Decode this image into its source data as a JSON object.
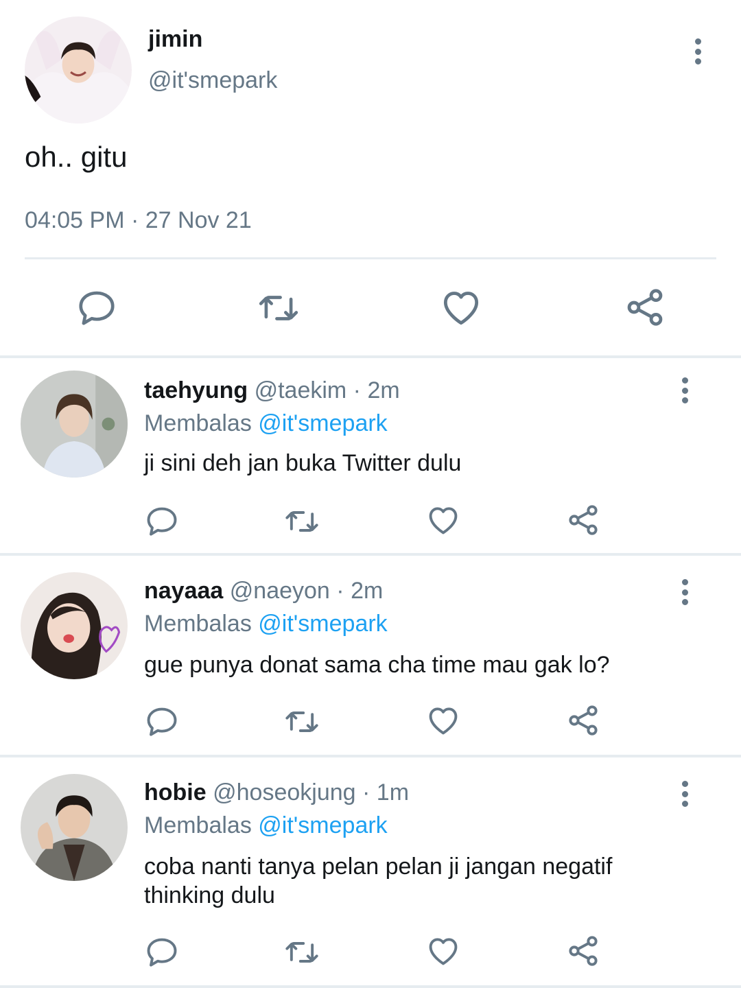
{
  "main_tweet": {
    "name": "jimin",
    "handle": "@it'smepark",
    "text": "oh.. gitu",
    "time": "04:05 PM",
    "separator": " · ",
    "date": "27 Nov 21"
  },
  "replies": [
    {
      "name": "taehyung",
      "handle": "@taekim",
      "dot": " · ",
      "time": "2m",
      "reply_label": "Membalas",
      "reply_to": "@it'smepark",
      "text": "ji sini deh jan buka Twitter dulu"
    },
    {
      "name": "nayaaa",
      "handle": "@naeyon",
      "dot": " · ",
      "time": "2m",
      "reply_label": "Membalas",
      "reply_to": "@it'smepark",
      "text": "gue punya donat sama cha time mau gak lo?"
    },
    {
      "name": "hobie",
      "handle": "@hoseokjung",
      "dot": " · ",
      "time": "1m",
      "reply_label": "Membalas",
      "reply_to": "@it'smepark",
      "text": "coba nanti tanya pelan pelan ji jangan negatif thinking dulu"
    }
  ],
  "icons": [
    "reply-icon",
    "retweet-icon",
    "like-icon",
    "share-icon",
    "more-options-icon"
  ],
  "colors": {
    "icon_gray": "#657786",
    "mention_blue": "#1da1f2",
    "divider": "#e6ecf0",
    "text": "#14171a"
  }
}
